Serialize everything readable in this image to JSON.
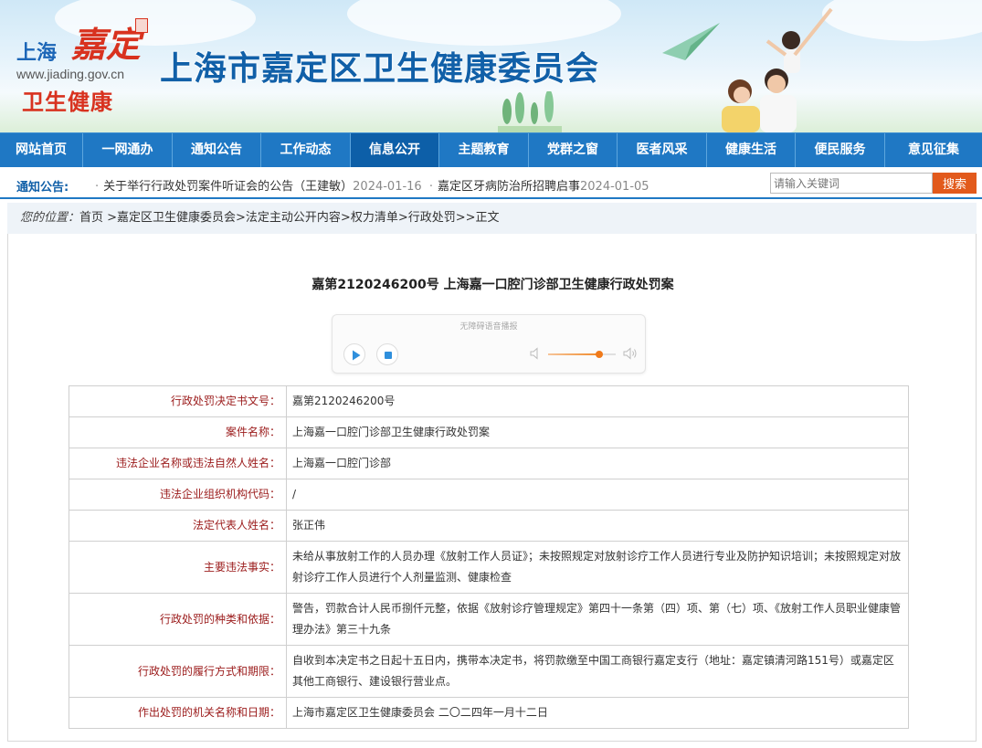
{
  "header": {
    "logo_shanghai": "上海",
    "logo_jiading": "嘉定",
    "logo_url": "www.jiading.gov.cn",
    "logo_weisheng": "卫生健康",
    "site_title": "上海市嘉定区卫生健康委员会"
  },
  "nav": {
    "items": [
      {
        "label": "网站首页"
      },
      {
        "label": "一网通办"
      },
      {
        "label": "通知公告"
      },
      {
        "label": "工作动态"
      },
      {
        "label": "信息公开"
      },
      {
        "label": "主题教育"
      },
      {
        "label": "党群之窗"
      },
      {
        "label": "医者风采"
      },
      {
        "label": "健康生活"
      },
      {
        "label": "便民服务"
      },
      {
        "label": "意见征集"
      }
    ],
    "active_index": 4
  },
  "notice": {
    "label": "通知公告:",
    "items": [
      {
        "title": "关于举行行政处罚案件听证会的公告（王建敏）",
        "date": "2024-01-16"
      },
      {
        "title": "嘉定区牙病防治所招聘启事",
        "date": "2024-01-05"
      }
    ]
  },
  "search": {
    "placeholder": "请输入关键词",
    "button_label": "搜索"
  },
  "breadcrumb": {
    "lead": "您的位置：",
    "path": "首页 >嘉定区卫生健康委员会>法定主动公开内容>权力清单>行政处罚>>正文"
  },
  "article": {
    "title": "嘉第2120246200号 上海嘉一口腔门诊部卫生健康行政处罚案"
  },
  "player": {
    "hint": "无障碍语音播报",
    "volume": 0.75
  },
  "table": {
    "rows": [
      {
        "key": "行政处罚决定书文号：",
        "value": "嘉第2120246200号"
      },
      {
        "key": "案件名称：",
        "value": "上海嘉一口腔门诊部卫生健康行政处罚案"
      },
      {
        "key": "违法企业名称或违法自然人姓名：",
        "value": "上海嘉一口腔门诊部"
      },
      {
        "key": "违法企业组织机构代码：",
        "value": "/"
      },
      {
        "key": "法定代表人姓名：",
        "value": "张正伟"
      },
      {
        "key": "主要违法事实：",
        "value": "未给从事放射工作的人员办理《放射工作人员证》；未按照规定对放射诊疗工作人员进行专业及防护知识培训；未按照规定对放射诊疗工作人员进行个人剂量监测、健康检查"
      },
      {
        "key": "行政处罚的种类和依据：",
        "value": "警告，罚款合计人民币捌仟元整，依据《放射诊疗管理规定》第四十一条第（四）项、第（七）项、《放射工作人员职业健康管理办法》第三十九条"
      },
      {
        "key": "行政处罚的履行方式和期限：",
        "value": "自收到本决定书之日起十五日内，携带本决定书，将罚款缴至中国工商银行嘉定支行（地址：嘉定镇清河路151号）或嘉定区其他工商银行、建设银行营业点。"
      },
      {
        "key": "作出处罚的机关名称和日期：",
        "value": "上海市嘉定区卫生健康委员会 二〇二四年一月十二日"
      }
    ]
  },
  "colors": {
    "nav_bg": "#1f78c4",
    "nav_active": "#0d5fa8",
    "title_blue": "#1160a8",
    "brand_red": "#d8321f",
    "search_orange": "#e25a1c",
    "key_red": "#9b1b1b"
  }
}
